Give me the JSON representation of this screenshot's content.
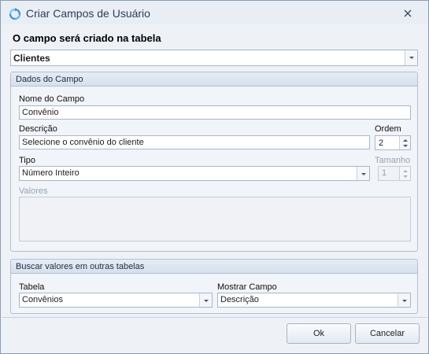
{
  "window": {
    "title": "Criar Campos de Usuário",
    "icon": "refresh-circle-icon"
  },
  "table_heading": "O campo será criado na tabela",
  "table_select": {
    "value": "Clientes"
  },
  "field_group": {
    "title": "Dados do Campo",
    "name_label": "Nome do Campo",
    "name_value": "Convênio",
    "description_label": "Descrição",
    "description_value": "Selecione o convênio do cliente",
    "order_label": "Ordem",
    "order_value": "2",
    "type_label": "Tipo",
    "type_value": "Número Inteiro",
    "size_label": "Tamanho",
    "size_value": "1",
    "values_label": "Valores"
  },
  "lookup_group": {
    "title": "Buscar valores em outras tabelas",
    "table_label": "Tabela",
    "table_value": "Convênios",
    "display_label": "Mostrar Campo",
    "display_value": "Descrição"
  },
  "buttons": {
    "ok": "Ok",
    "cancel": "Cancelar"
  }
}
